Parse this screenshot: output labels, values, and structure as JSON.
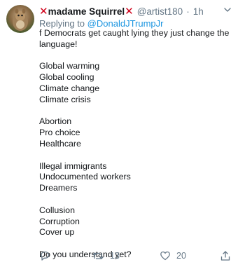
{
  "tweet": {
    "display_name": "madame Squirrel",
    "handle": "@artist180",
    "separator": "·",
    "time": "1h",
    "replying_prefix": "Replying to",
    "replying_to": "@DonaldJTrumpJr",
    "lines": [
      "f Democrats get caught lying they just change the language!",
      "",
      "Global warming",
      "Global cooling",
      "Climate change",
      "Climate crisis",
      "",
      "Abortion",
      "Pro choice",
      "Healthcare",
      "",
      "Illegal immigrants",
      "Undocumented workers",
      "Dreamers",
      "",
      "Collusion",
      "Corruption",
      "Cover up",
      "",
      "Do you understand yet?"
    ],
    "retweet_count": "13",
    "like_count": "20"
  },
  "icons": {
    "name_marks": "red-x-icon",
    "menu": "chevron-down-icon",
    "reply": "reply-icon",
    "retweet": "retweet-icon",
    "like": "heart-icon",
    "share": "share-icon"
  },
  "colors": {
    "x_mark": "#d0021b",
    "link": "#1b95e0",
    "muted": "#657786",
    "text": "#14171a"
  }
}
